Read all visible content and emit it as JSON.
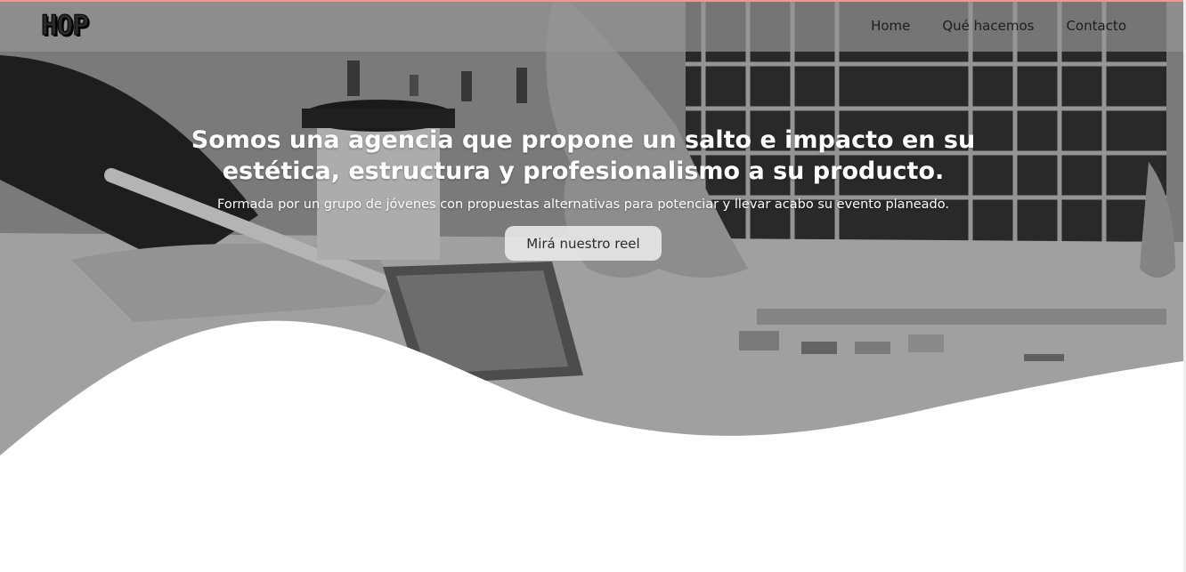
{
  "brand": {
    "logo_text": "HOP"
  },
  "nav": {
    "items": [
      "Home",
      "Qué hacemos",
      "Contacto"
    ]
  },
  "hero": {
    "title": "Somos una agencia que propone un salto e impacto en su estética, estructura y profesionalismo a su producto.",
    "subtitle": "Formada por un grupo de jóvenes con propuestas alternativas para potenciar y llevar acabo su evento planeado.",
    "cta_label": "Mirá nuestro reel"
  },
  "colors": {
    "overlay": "#969696",
    "cta_bg": "#ebebeb",
    "text_light": "#ffffff",
    "nav_text": "#1e1e1e"
  }
}
